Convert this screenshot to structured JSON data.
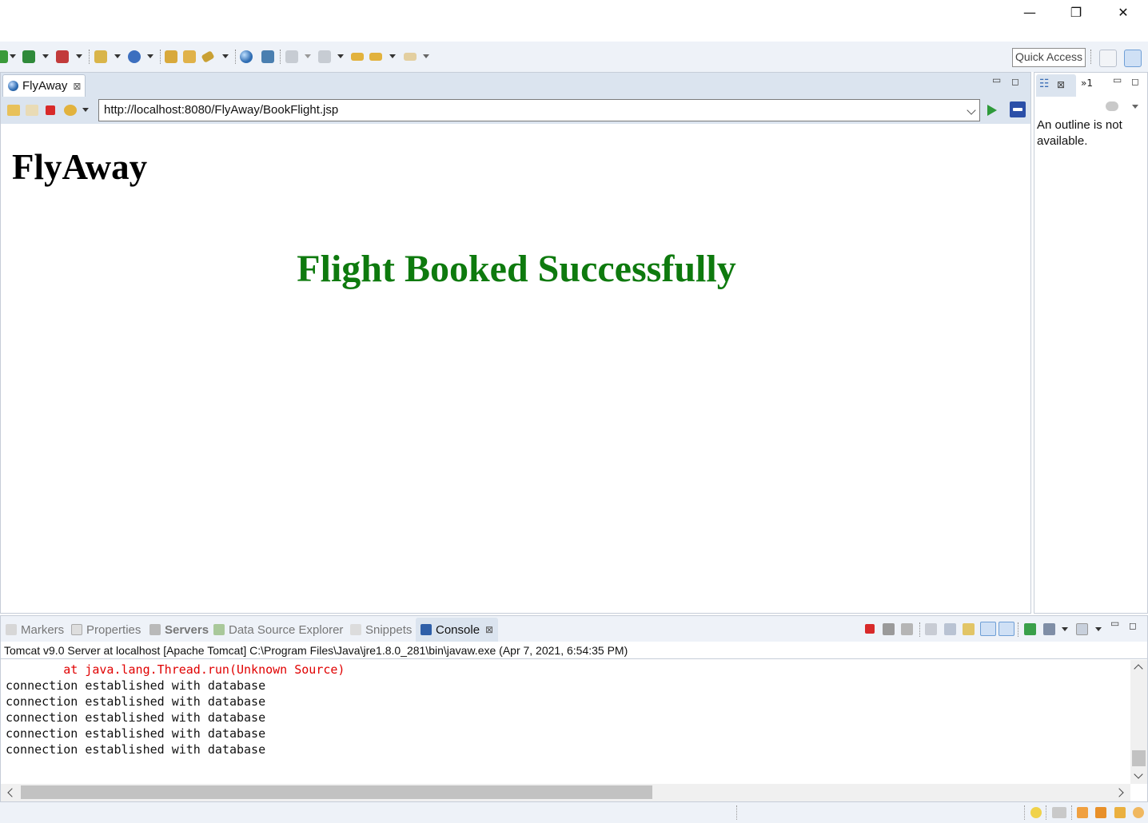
{
  "window": {
    "minimize_glyph": "—",
    "restore_glyph": "❐",
    "close_glyph": "✕"
  },
  "toolbar": {
    "quick_access_label": "Quick Access"
  },
  "editor": {
    "tab_label": "FlyAway",
    "tab_close_glyph": "⊠",
    "url": "http://localhost:8080/FlyAway/BookFlight.jsp",
    "page": {
      "heading": "FlyAway",
      "message": "Flight Booked Successfully"
    }
  },
  "outline": {
    "tab_label": "☷",
    "tab_close_glyph": "⊠",
    "overflow_label": "»1",
    "empty_message": "An outline is not available."
  },
  "bottom_panel": {
    "tabs": [
      {
        "label": "Markers",
        "active": false
      },
      {
        "label": "Properties",
        "active": false
      },
      {
        "label": "Servers",
        "active": false
      },
      {
        "label": "Data Source Explorer",
        "active": false
      },
      {
        "label": "Snippets",
        "active": false
      },
      {
        "label": "Console",
        "active": true
      }
    ],
    "console_close_glyph": "⊠",
    "console_description": "Tomcat v9.0 Server at localhost [Apache Tomcat] C:\\Program Files\\Java\\jre1.8.0_281\\bin\\javaw.exe (Apr 7, 2021, 6:54:35 PM)",
    "console_lines": [
      {
        "text": "        at java.lang.Thread.run(Unknown Source)",
        "error": true
      },
      {
        "text": "connection established with database",
        "error": false
      },
      {
        "text": "connection established with database",
        "error": false
      },
      {
        "text": "connection established with database",
        "error": false
      },
      {
        "text": "connection established with database",
        "error": false
      },
      {
        "text": "connection established with database",
        "error": false
      }
    ]
  },
  "colors": {
    "success_green": "#0e7a0e",
    "error_red": "#e00000",
    "toolbar_bg": "#eef2f8",
    "tab_bg": "#dbe4ef"
  }
}
